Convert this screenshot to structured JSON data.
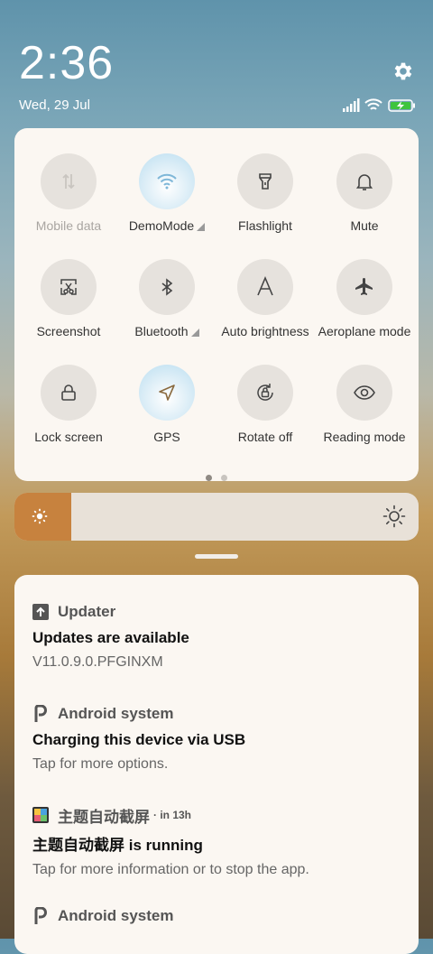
{
  "status": {
    "time": "2:36",
    "date": "Wed, 29 Jul",
    "icons": [
      "signal-icon",
      "wifi-icon",
      "battery-charging-icon"
    ],
    "battery_color": "#3ec43e"
  },
  "quick_settings": {
    "tiles": [
      {
        "label": "Mobile data",
        "icon": "mobile-data-icon"
      },
      {
        "label": "DemoMode",
        "icon": "wifi-icon"
      },
      {
        "label": "Flashlight",
        "icon": "flashlight-icon"
      },
      {
        "label": "Mute",
        "icon": "bell-icon"
      },
      {
        "label": "Screenshot",
        "icon": "screenshot-icon"
      },
      {
        "label": "Bluetooth",
        "icon": "bluetooth-icon"
      },
      {
        "label": "Auto brightness",
        "icon": "auto-brightness-icon"
      },
      {
        "label": "Aeroplane mode",
        "icon": "airplane-icon"
      },
      {
        "label": "Lock screen",
        "icon": "lock-icon"
      },
      {
        "label": "GPS",
        "icon": "location-icon"
      },
      {
        "label": "Rotate off",
        "icon": "rotate-lock-icon"
      },
      {
        "label": "Reading mode",
        "icon": "eye-icon"
      }
    ],
    "page": 1,
    "pages": 2
  },
  "brightness": {
    "level": 0.14,
    "accent": "#c7823e"
  },
  "notifications": [
    {
      "app": "Updater",
      "time": "",
      "title": "Updates are available",
      "body": "V11.0.9.0.PFGINXM"
    },
    {
      "app": "Android system",
      "time": "",
      "title": "Charging this device via USB",
      "body": "Tap for more options."
    },
    {
      "app": "主题自动截屏",
      "time": "· in 13h",
      "title": "主题自动截屏 is running",
      "body": "Tap for more information or to stop the app."
    },
    {
      "app": "Android system",
      "time": "",
      "title": "",
      "body": ""
    }
  ]
}
